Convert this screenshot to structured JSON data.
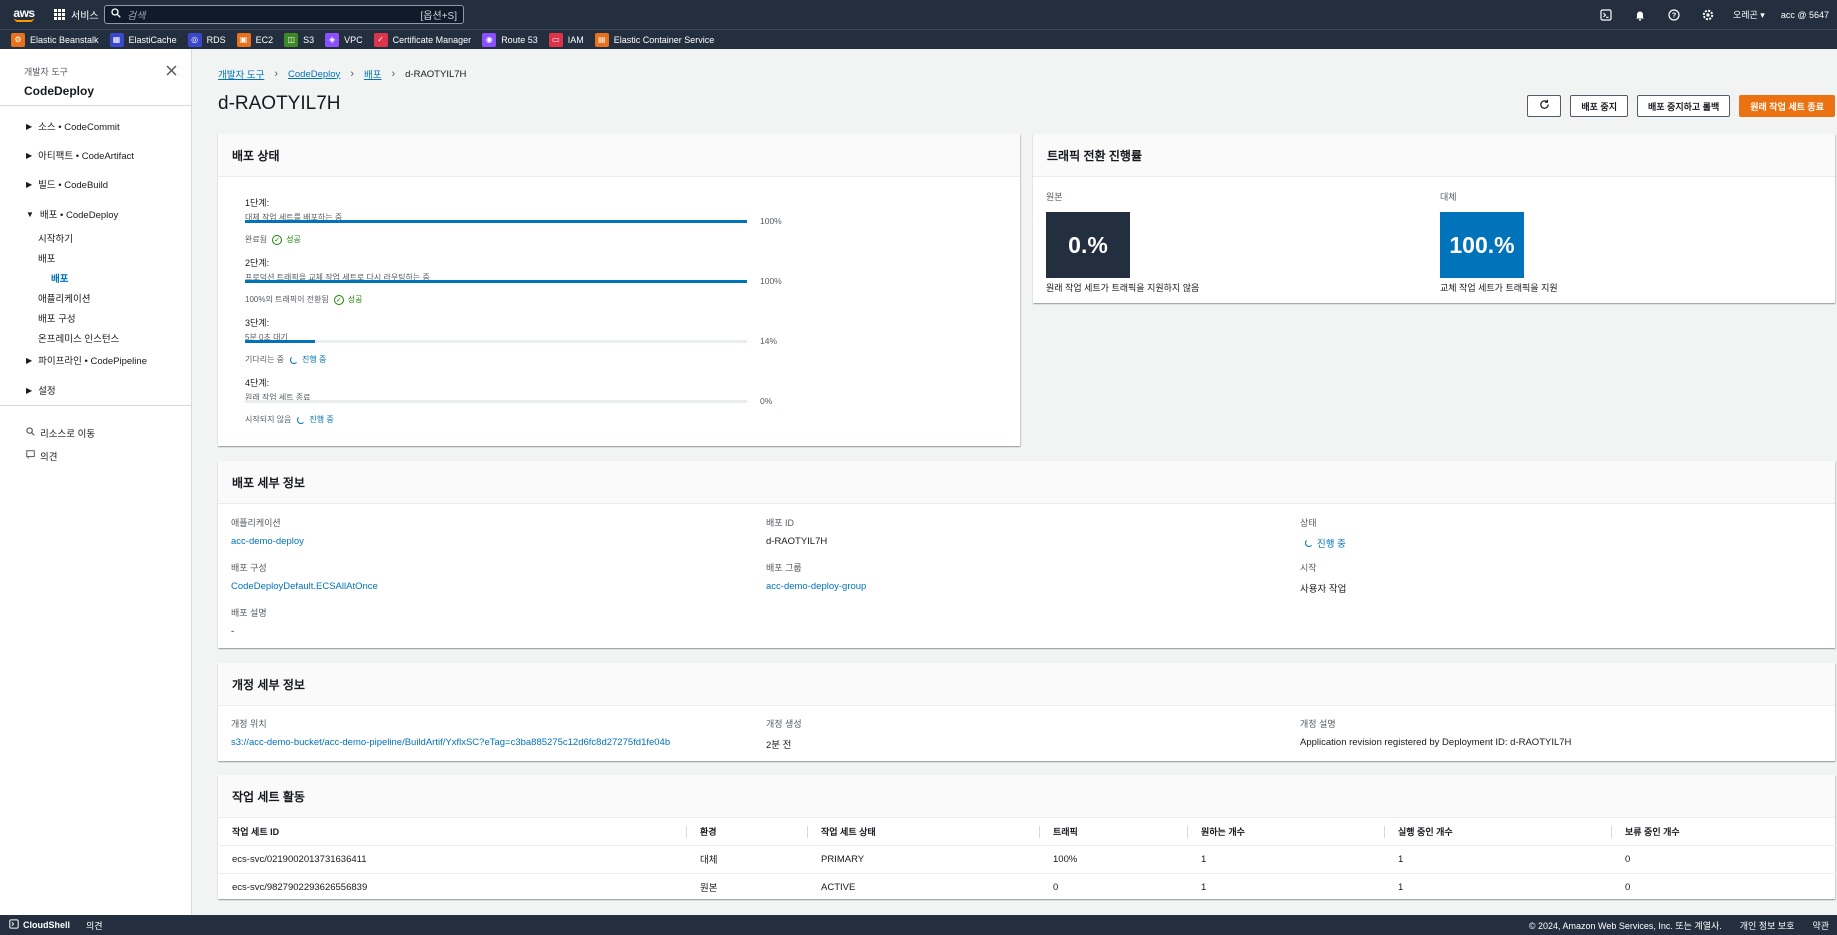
{
  "topbar": {
    "logo": "aws",
    "services": "서비스",
    "search_placeholder": "검색",
    "search_shortcut": "[옵션+S]",
    "region": "오레곤 ▾",
    "account": "acc @ 5647",
    "icons": [
      "cloudshell-icon",
      "bell-icon",
      "help-icon",
      "gear-icon"
    ]
  },
  "favorites": [
    {
      "label": "Elastic Beanstalk",
      "color": "#e7711c",
      "glyph": "⚙"
    },
    {
      "label": "ElastiCache",
      "color": "#3b48cc",
      "glyph": "▦"
    },
    {
      "label": "RDS",
      "color": "#3b48cc",
      "glyph": "◎"
    },
    {
      "label": "EC2",
      "color": "#e7711c",
      "glyph": "▣"
    },
    {
      "label": "S3",
      "color": "#3f8624",
      "glyph": "◫"
    },
    {
      "label": "VPC",
      "color": "#8c4fff",
      "glyph": "◈"
    },
    {
      "label": "Certificate Manager",
      "color": "#dd344c",
      "glyph": "✓"
    },
    {
      "label": "Route 53",
      "color": "#8c4fff",
      "glyph": "◉"
    },
    {
      "label": "IAM",
      "color": "#dd344c",
      "glyph": "▭"
    },
    {
      "label": "Elastic Container Service",
      "color": "#e7711c",
      "glyph": "▤"
    }
  ],
  "sidebar": {
    "category": "개발자 도구",
    "title": "CodeDeploy",
    "groups": {
      "g1": "소스 • CodeCommit",
      "g2": "아티팩트 • CodeArtifact",
      "g3": "빌드 • CodeBuild",
      "g4": "배포 • CodeDeploy",
      "g5": "파이프라인 • CodePipeline",
      "g6": "설정"
    },
    "deploy_items": {
      "start": "시작하기",
      "deploy": "배포",
      "deploy_sub": "배포",
      "apps": "애플리케이션",
      "config": "배포 구성",
      "onprem": "온프레미스 인스턴스"
    },
    "goto_resource": "리소스로 이동",
    "feedback": "의견"
  },
  "breadcrumb": [
    "개발자 도구",
    "CodeDeploy",
    "배포",
    "d-RAOTYIL7H"
  ],
  "page_title": "d-RAOTYIL7H",
  "actions": {
    "stop": "배포 중지",
    "stop_rollback": "배포 중지하고 롤백",
    "terminate": "원래 작업 세트 종료"
  },
  "deploy_status": {
    "title": "배포 상태",
    "stages": [
      {
        "label": "1단계:",
        "desc": "대체 작업 세트를 배포하는 중",
        "pct_text": "100%",
        "progress": 1.0,
        "state": "완료됨",
        "badge": "성공",
        "kind": "ok"
      },
      {
        "label": "2단계:",
        "desc": "프로덕션 트래픽을 교체 작업 세트로 다시 라우팅하는 중",
        "pct_text": "100%",
        "progress": 1.0,
        "state": "100%의 트래픽이 전환됨",
        "badge": "성공",
        "kind": "ok"
      },
      {
        "label": "3단계:",
        "desc": "5분 0초 대기",
        "pct_text": "14%",
        "progress": 0.14,
        "state": "기다리는 중",
        "badge": "진행 중",
        "kind": "prog"
      },
      {
        "label": "4단계:",
        "desc": "원래 작업 세트 종료",
        "pct_text": "0%",
        "progress": 0.0,
        "state": "시작되지 않음",
        "badge": "진행 중",
        "kind": "prog"
      }
    ]
  },
  "traffic": {
    "title": "트래픽 전환 진행률",
    "original": {
      "caption": "원본",
      "value": "0.%",
      "footer": "원래 작업 세트가 트래픽을 지원하지 않음",
      "color": "#232f3e"
    },
    "replacement": {
      "caption": "대체",
      "value": "100.%",
      "footer": "교체 작업 세트가 트래픽을 지원",
      "color": "#0073bb"
    }
  },
  "deploy_details": {
    "title": "배포 세부 정보",
    "application_k": "애플리케이션",
    "application_v": "acc-demo-deploy",
    "deploy_id_k": "배포 ID",
    "deploy_id_v": "d-RAOTYIL7H",
    "status_k": "상태",
    "status_v": "진행 중",
    "config_k": "배포 구성",
    "config_v": "CodeDeployDefault.ECSAllAtOnce",
    "group_k": "배포 그룹",
    "group_v": "acc-demo-deploy-group",
    "start_k": "시작",
    "start_v": "사용자 작업",
    "desc_k": "배포 설명",
    "desc_v": "-"
  },
  "revision": {
    "title": "개정 세부 정보",
    "location_k": "개정 위치",
    "location_v": "s3://acc-demo-bucket/acc-demo-pipeline/BuildArtif/YxflxSC?eTag=c3ba885275c12d6fc8d27275fd1fe04b",
    "created_k": "개정 생성",
    "created_v": "2분 전",
    "desc_k": "개정 설명",
    "desc_v": "Application revision registered by Deployment ID: d-RAOTYIL7H"
  },
  "taskset": {
    "title": "작업 세트 활동",
    "headers": [
      "작업 세트 ID",
      "환경",
      "작업 세트 상태",
      "트래픽",
      "원하는 개수",
      "실행 중인 개수",
      "보류 중인 개수"
    ],
    "rows": [
      [
        "ecs-svc/0219002013731636411",
        "대체",
        "PRIMARY",
        "100%",
        "1",
        "1",
        "0"
      ],
      [
        "ecs-svc/9827902293626556839",
        "원본",
        "ACTIVE",
        "0",
        "1",
        "1",
        "0"
      ]
    ]
  },
  "footer": {
    "cloudshell": "CloudShell",
    "feedback": "의견",
    "copyright": "© 2024, Amazon Web Services, Inc. 또는 계열사.",
    "privacy": "개인 정보 보호",
    "terms": "약관"
  }
}
